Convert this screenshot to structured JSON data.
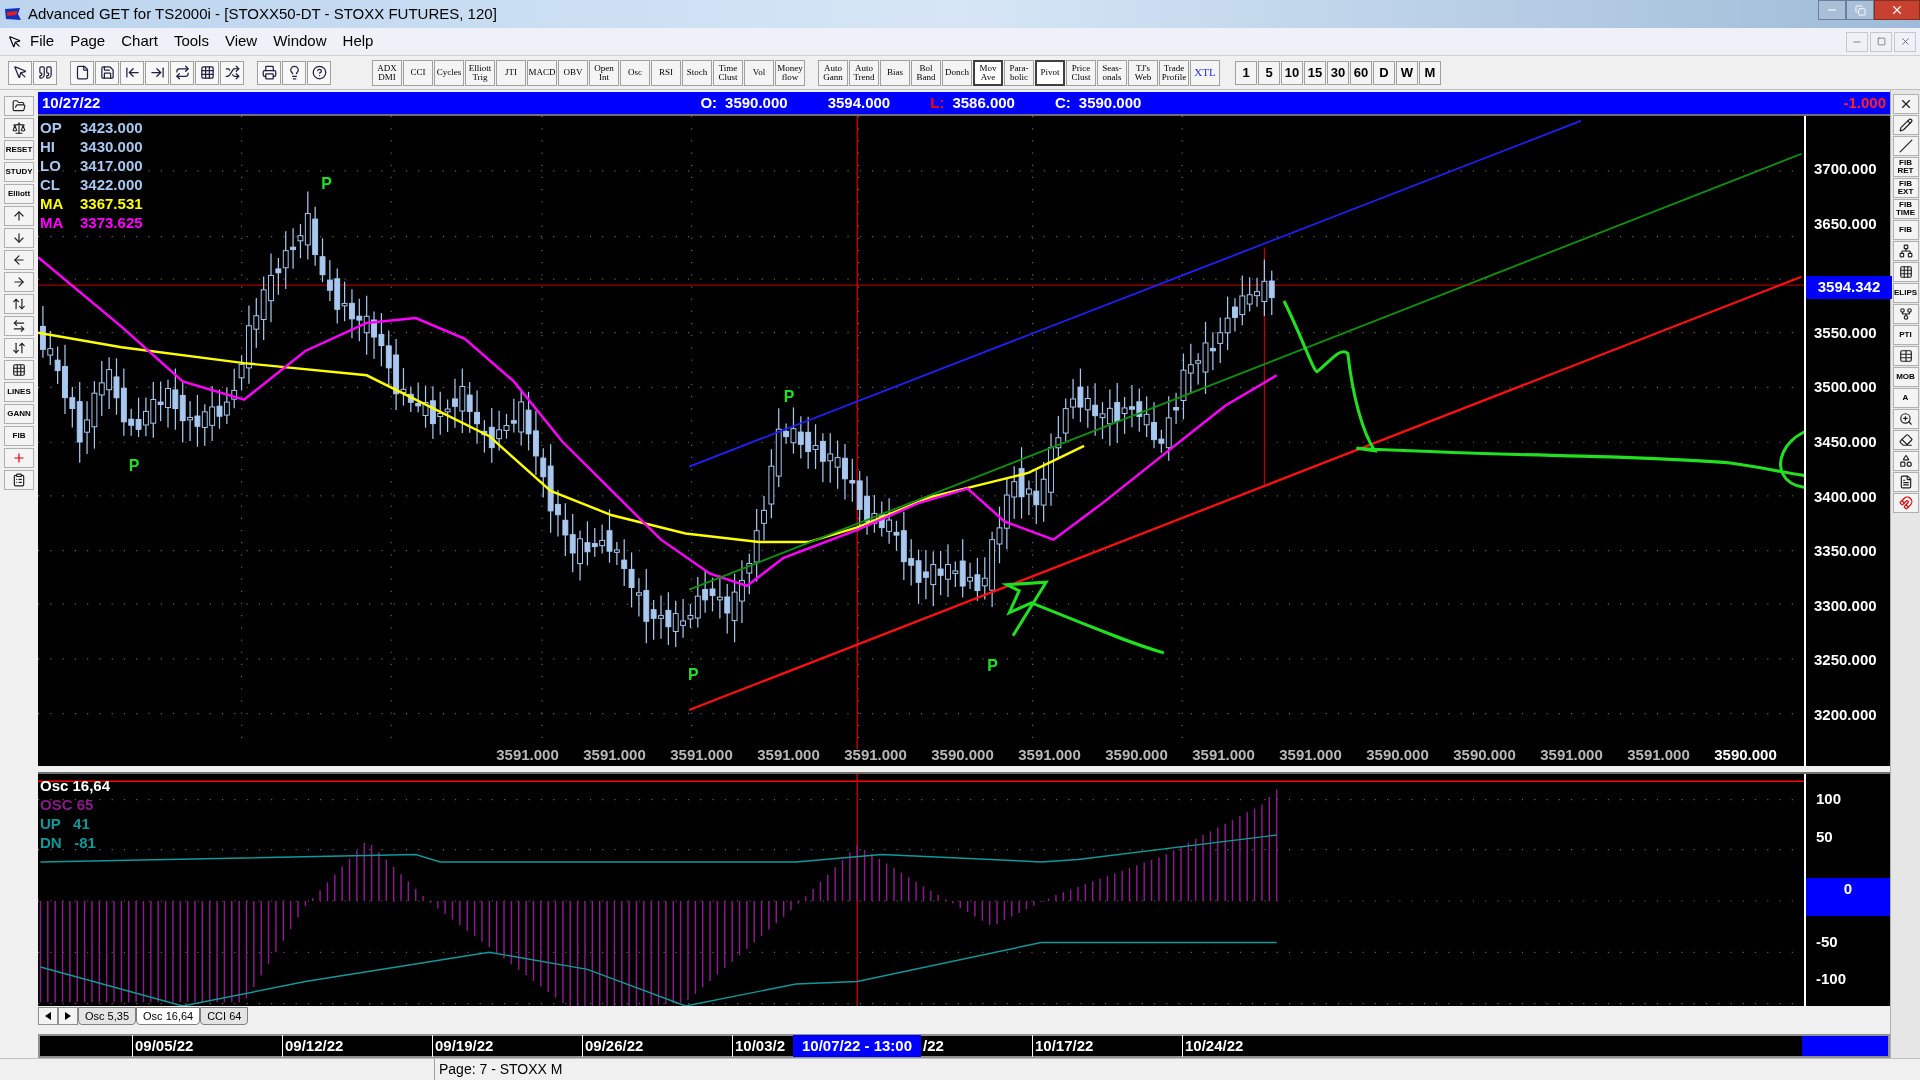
{
  "window": {
    "title": "Advanced GET for TS2000i - [STOXX50-DT - STOXX FUTURES, 120]"
  },
  "menu": [
    "File",
    "Page",
    "Chart",
    "Tools",
    "View",
    "Window",
    "Help"
  ],
  "study_buttons": [
    {
      "label": "ADX\nDMI",
      "selected": false
    },
    {
      "label": "CCI",
      "selected": false
    },
    {
      "label": "Cycles",
      "selected": false
    },
    {
      "label": "Elliott\nTrig",
      "selected": false
    },
    {
      "label": "JTI",
      "selected": false
    },
    {
      "label": "MACD",
      "selected": false
    },
    {
      "label": "OBV",
      "selected": false
    },
    {
      "label": "Open\nInt",
      "selected": false
    },
    {
      "label": "Osc",
      "selected": false
    },
    {
      "label": "RSI",
      "selected": false
    },
    {
      "label": "Stoch",
      "selected": false
    },
    {
      "label": "Time\nClust",
      "selected": false
    },
    {
      "label": "Vol",
      "selected": false
    },
    {
      "label": "Money\nflow",
      "selected": false
    }
  ],
  "overlay_buttons": [
    {
      "label": "Auto\nGann",
      "selected": false
    },
    {
      "label": "Auto\nTrend",
      "selected": false
    },
    {
      "label": "Bias",
      "selected": false
    },
    {
      "label": "Bol\nBand",
      "selected": false
    },
    {
      "label": "Donch",
      "selected": false
    },
    {
      "label": "Mov\nAve",
      "selected": true
    },
    {
      "label": "Para-\nbolic",
      "selected": false
    },
    {
      "label": "Pivot",
      "selected": true
    },
    {
      "label": "Price\nClust",
      "selected": false
    },
    {
      "label": "Seas-\nonals",
      "selected": false
    },
    {
      "label": "TJ's\nWeb",
      "selected": false
    },
    {
      "label": "Trade\nProfile",
      "selected": false
    },
    {
      "label": "XTL",
      "selected": false
    }
  ],
  "interval_buttons": [
    "1",
    "5",
    "10",
    "15",
    "30",
    "60",
    "D",
    "W",
    "M"
  ],
  "left_tools": [
    {
      "kind": "folder"
    },
    {
      "kind": "scales"
    },
    {
      "kind": "label",
      "label": "RESET"
    },
    {
      "kind": "label",
      "label": "STUDY"
    },
    {
      "kind": "label",
      "label": "Elliott"
    },
    {
      "kind": "up"
    },
    {
      "kind": "down"
    },
    {
      "kind": "left"
    },
    {
      "kind": "right"
    },
    {
      "kind": "bars"
    },
    {
      "kind": "hsqueeze"
    },
    {
      "kind": "vsqueeze"
    },
    {
      "kind": "grid"
    },
    {
      "kind": "label",
      "label": "LINES"
    },
    {
      "kind": "label",
      "label": "GANN"
    },
    {
      "kind": "label",
      "label": "FIB"
    },
    {
      "kind": "crosshair"
    },
    {
      "kind": "clipboard"
    }
  ],
  "right_tools": [
    {
      "kind": "close"
    },
    {
      "kind": "pencil"
    },
    {
      "kind": "lines"
    },
    {
      "kind": "label",
      "label": "FIB\nRET"
    },
    {
      "kind": "label",
      "label": "FIB\nEXT"
    },
    {
      "kind": "label",
      "label": "FIB\nTIME"
    },
    {
      "kind": "label",
      "label": "FIB"
    },
    {
      "kind": "fan"
    },
    {
      "kind": "grid"
    },
    {
      "kind": "label",
      "label": "ELIPS"
    },
    {
      "kind": "pitchfork"
    },
    {
      "kind": "label",
      "label": "PTI"
    },
    {
      "kind": "table"
    },
    {
      "kind": "label",
      "label": "MOB"
    },
    {
      "kind": "label",
      "label": "A"
    },
    {
      "kind": "zoom"
    },
    {
      "kind": "eraser"
    },
    {
      "kind": "pattern"
    },
    {
      "kind": "document"
    },
    {
      "kind": "magnet"
    }
  ],
  "info_bar": {
    "date": "10/27/22",
    "quotes": [
      {
        "label": "O:",
        "value": "3590.000"
      },
      {
        "value": "3594.000"
      },
      {
        "label": "L:",
        "value": "3586.000",
        "color": "#ff0000"
      },
      {
        "label": "C:",
        "value": "3590.000"
      }
    ],
    "change": "-1.000"
  },
  "price_legend": [
    {
      "label": "OP",
      "value": "3423.000",
      "color": "#a8c8f0"
    },
    {
      "label": "HI",
      "value": "3430.000",
      "color": "#a8c8f0"
    },
    {
      "label": "LO",
      "value": "3417.000",
      "color": "#a8c8f0"
    },
    {
      "label": "CL",
      "value": "3422.000",
      "color": "#a8c8f0"
    },
    {
      "label": "MA",
      "value": "3367.531",
      "color": "#ffff00"
    },
    {
      "label": "MA",
      "value": "3373.625",
      "color": "#ff00ff"
    }
  ],
  "pivot_labels": [
    "P",
    "P",
    "P",
    "P",
    "P"
  ],
  "price_axis": [
    "3700.000",
    "3650.000",
    "3550.000",
    "3500.000",
    "3450.000",
    "3400.000",
    "3350.000",
    "3300.000",
    "3250.000",
    "3200.000"
  ],
  "current_price": "3594.342",
  "bottom_values": [
    {
      "text": "3591.000",
      "current": false
    },
    {
      "text": "3591.000",
      "current": false
    },
    {
      "text": "3591.000",
      "current": false
    },
    {
      "text": "3591.000",
      "current": false
    },
    {
      "text": "3591.000",
      "current": false
    },
    {
      "text": "3590.000",
      "current": false
    },
    {
      "text": "3591.000",
      "current": false
    },
    {
      "text": "3590.000",
      "current": false
    },
    {
      "text": "3591.000",
      "current": false
    },
    {
      "text": "3591.000",
      "current": false
    },
    {
      "text": "3590.000",
      "current": false
    },
    {
      "text": "3590.000",
      "current": false
    },
    {
      "text": "3591.000",
      "current": false
    },
    {
      "text": "3591.000",
      "current": false
    },
    {
      "text": "3590.000",
      "current": true
    }
  ],
  "osc_legend": [
    {
      "label": "Osc 16,64",
      "color": "#ffffff"
    },
    {
      "label": "OSC 65",
      "color": "#8b1a8b"
    },
    {
      "label": "UP   41",
      "color": "#119999"
    },
    {
      "label": "DN   -81",
      "color": "#119999"
    }
  ],
  "osc_axis": [
    {
      "text": "100",
      "current": false
    },
    {
      "text": "50",
      "current": false
    },
    {
      "text": "0",
      "current": true
    },
    {
      "text": "-50",
      "current": false
    },
    {
      "text": "-100",
      "current": false
    }
  ],
  "osc_tabs": [
    {
      "label": "Osc 5,35",
      "selected": false
    },
    {
      "label": "Osc 16,64",
      "selected": true
    },
    {
      "label": "CCI 64",
      "selected": false
    }
  ],
  "date_axis": {
    "dates_before": [
      "09/05/22",
      "09/12/22",
      "09/19/22",
      "09/26/22",
      "10/03/2"
    ],
    "cursor": "10/07/22 - 13:00",
    "dates_after": [
      "/22",
      "10/17/22",
      "10/24/22"
    ]
  },
  "status_bar": "Page: 7 - STOXX M"
}
